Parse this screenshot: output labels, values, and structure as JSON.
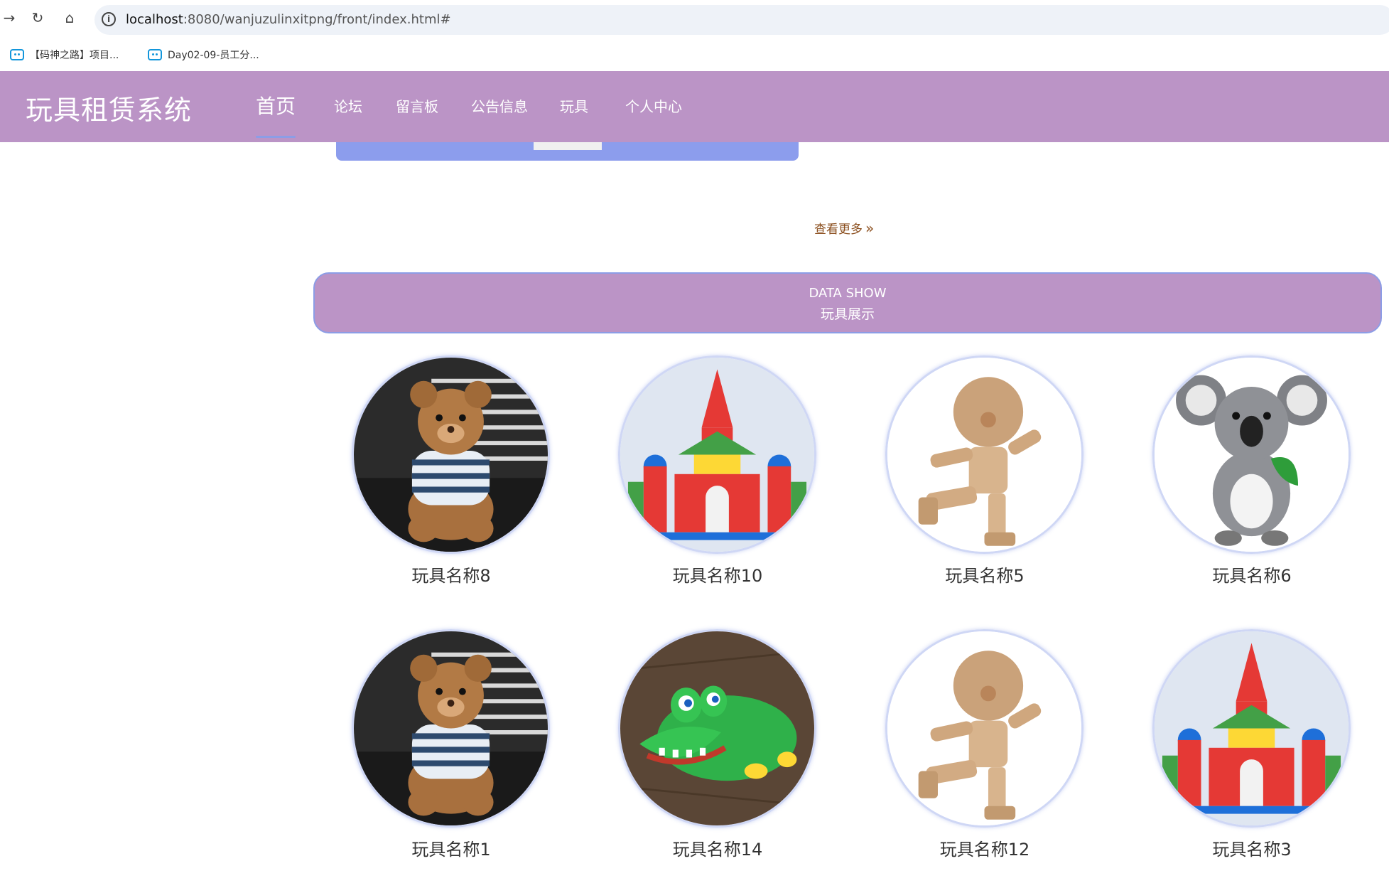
{
  "browser": {
    "url_host": "localhost",
    "url_rest": ":8080/wanjuzulinxitpng/front/index.html#",
    "bookmarks": [
      {
        "label": "【码神之路】项目..."
      },
      {
        "label": "Day02-09-员工分..."
      }
    ]
  },
  "header": {
    "logo": "玩具租赁系统",
    "menu": [
      {
        "label": "首页",
        "active": true
      },
      {
        "label": "论坛"
      },
      {
        "label": "留言板"
      },
      {
        "label": "公告信息"
      },
      {
        "label": "玩具"
      },
      {
        "label": "个人中心"
      }
    ]
  },
  "main": {
    "more_label": "查看更多",
    "section": {
      "title_en": "DATA SHOW",
      "title_zh": "玩具展示"
    },
    "products": [
      {
        "name": "玩具名称8",
        "image": "teddy-bear"
      },
      {
        "name": "玩具名称10",
        "image": "block-castle"
      },
      {
        "name": "玩具名称5",
        "image": "wooden-doll"
      },
      {
        "name": "玩具名称6",
        "image": "koala-plush"
      },
      {
        "name": "玩具名称1",
        "image": "teddy-bear"
      },
      {
        "name": "玩具名称14",
        "image": "crocodile-toy"
      },
      {
        "name": "玩具名称12",
        "image": "wooden-doll"
      },
      {
        "name": "玩具名称3",
        "image": "block-castle"
      }
    ]
  },
  "colors": {
    "header": "#bb94c6",
    "accent": "#8c9de6",
    "link": "#8a4d1c"
  }
}
